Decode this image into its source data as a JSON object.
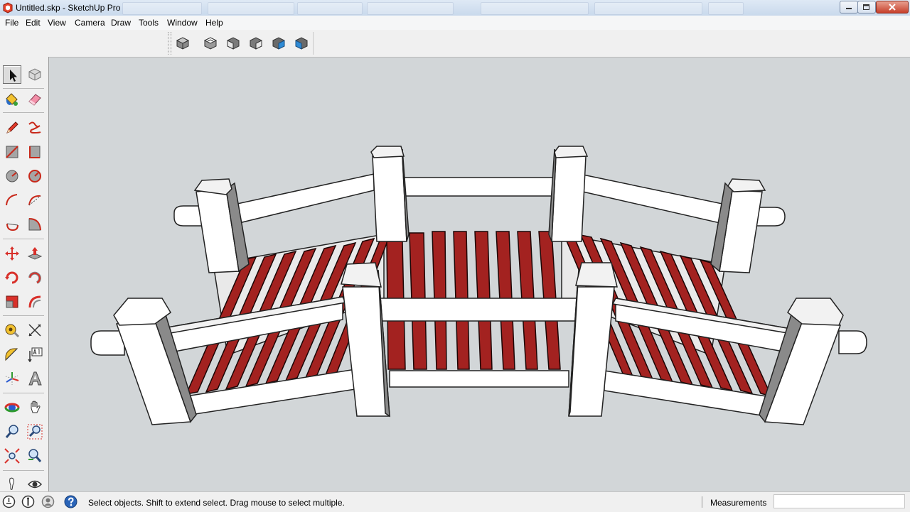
{
  "window": {
    "title": "Untitled.skp - SketchUp Pro"
  },
  "menu": [
    "File",
    "Edit",
    "View",
    "Camera",
    "Draw",
    "Tools",
    "Window",
    "Help"
  ],
  "toolbar_top": {
    "buttons": [
      "iso-view-icon",
      "top-view-icon",
      "front-view-icon",
      "right-view-icon",
      "back-view-icon",
      "left-view-icon"
    ]
  },
  "toolbar_left": {
    "tools": [
      [
        "select-arrow-icon",
        "make-component-icon"
      ],
      [
        "paint-bucket-icon",
        "eraser-icon"
      ],
      [
        "pencil-line-icon",
        "freehand-icon"
      ],
      [
        "rectangle-icon",
        "rotated-rectangle-icon"
      ],
      [
        "circle-icon",
        "polygon-icon"
      ],
      [
        "arc-icon",
        "two-point-arc-icon"
      ],
      [
        "pie-icon",
        "three-point-arc-icon"
      ],
      [
        "move-icon",
        "push-pull-icon"
      ],
      [
        "rotate-icon",
        "follow-me-icon"
      ],
      [
        "scale-icon",
        "offset-icon"
      ],
      [
        "tape-measure-icon",
        "dimension-icon"
      ],
      [
        "protractor-icon",
        "text-icon"
      ],
      [
        "axes-icon",
        "3d-text-icon"
      ],
      [
        "orbit-icon",
        "pan-icon"
      ],
      [
        "zoom-icon",
        "zoom-window-icon"
      ],
      [
        "zoom-extents-icon",
        "position-camera-icon"
      ],
      [
        "walk-icon",
        "look-around-icon"
      ]
    ]
  },
  "model": {
    "deck_color": "#a32220",
    "frame_color": "#ffffff"
  },
  "status": {
    "icons": [
      "geo-location-icon",
      "credits-icon",
      "user-icon",
      "instructor-help-icon"
    ],
    "message": "Select objects. Shift to extend select. Drag mouse to select multiple.",
    "measurements_label": "Measurements",
    "measurements_value": ""
  }
}
